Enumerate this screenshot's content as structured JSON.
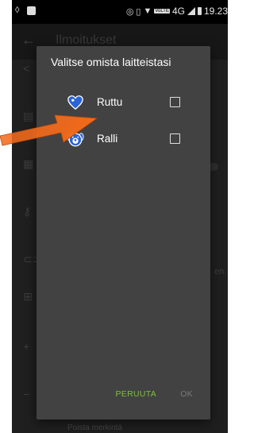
{
  "status_bar": {
    "time": "19.23",
    "network": "4G",
    "volte_badge": "VoLTE"
  },
  "app_bar": {
    "title": "Ilmoitukset"
  },
  "background": {
    "partial_text": "en.",
    "bottom_text": "Poista merkintä"
  },
  "dialog": {
    "title": "Valitse omista laitteistasi",
    "devices": [
      {
        "name": "Ruttu",
        "icon": "heart-pin-icon",
        "checked": false
      },
      {
        "name": "Ralli",
        "icon": "dog-face-icon",
        "checked": false
      }
    ],
    "cancel_label": "PERUUTA",
    "ok_label": "OK"
  },
  "colors": {
    "dialog_bg": "#424242",
    "screen_bg": "#262626",
    "accent_green": "#7fbf3f",
    "arrow_orange": "#f26a1b",
    "device_icon_blue": "#2a63d6"
  }
}
